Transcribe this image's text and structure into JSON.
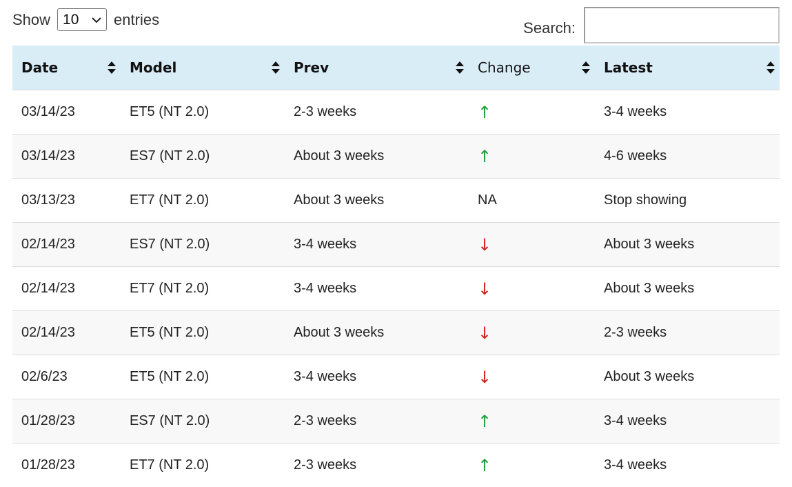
{
  "controls": {
    "show_label": "Show",
    "page_length": "10",
    "entries_label": "entries",
    "search_label": "Search:",
    "search_value": ""
  },
  "colors": {
    "header_bg": "#d9edf7",
    "arrow_up": "#1f9d3c",
    "arrow_down": "#d42424"
  },
  "table": {
    "columns": [
      "Date",
      "Model",
      "Prev",
      "Change",
      "Latest"
    ],
    "rows": [
      {
        "date": "03/14/23",
        "model": "ET5 (NT 2.0)",
        "prev": "2-3 weeks",
        "change": "↑",
        "latest": "3-4 weeks"
      },
      {
        "date": "03/14/23",
        "model": "ES7 (NT 2.0)",
        "prev": "About 3 weeks",
        "change": "↑",
        "latest": "4-6 weeks"
      },
      {
        "date": "03/13/23",
        "model": "ET7 (NT 2.0)",
        "prev": "About 3 weeks",
        "change": "NA",
        "latest": "Stop showing"
      },
      {
        "date": "02/14/23",
        "model": "ES7 (NT 2.0)",
        "prev": "3-4 weeks",
        "change": "↓",
        "latest": "About 3 weeks"
      },
      {
        "date": "02/14/23",
        "model": "ET7 (NT 2.0)",
        "prev": "3-4 weeks",
        "change": "↓",
        "latest": "About 3 weeks"
      },
      {
        "date": "02/14/23",
        "model": "ET5 (NT 2.0)",
        "prev": "About 3 weeks",
        "change": "↓",
        "latest": "2-3 weeks"
      },
      {
        "date": "02/6/23",
        "model": "ET5 (NT 2.0)",
        "prev": "3-4 weeks",
        "change": "↓",
        "latest": "About 3 weeks"
      },
      {
        "date": "01/28/23",
        "model": "ES7 (NT 2.0)",
        "prev": "2-3 weeks",
        "change": "↑",
        "latest": "3-4 weeks"
      },
      {
        "date": "01/28/23",
        "model": "ET7 (NT 2.0)",
        "prev": "2-3 weeks",
        "change": "↑",
        "latest": "3-4 weeks"
      }
    ]
  }
}
